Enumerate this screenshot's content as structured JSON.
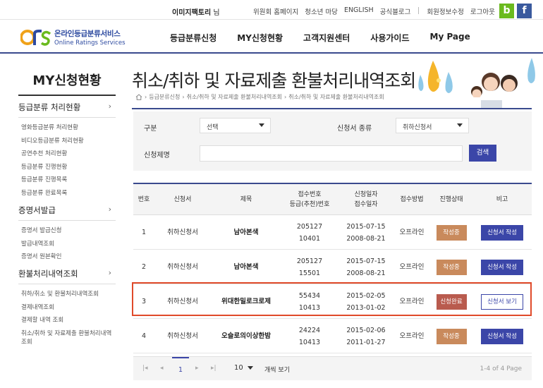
{
  "topbar": {
    "user_name": "이미지팩토리",
    "user_suffix": "님",
    "links": [
      "위원회 홈페이지",
      "청소년 마당",
      "ENGLISH",
      "공식블로그"
    ],
    "account_links": [
      "회원정보수정",
      "로그아웃"
    ],
    "blog_icon_text": "b",
    "facebook_icon_text": "f"
  },
  "header": {
    "logo_ko": "온라인등급분류서비스",
    "logo_en": "Online Ratings Services",
    "nav": [
      "등급분류신청",
      "MY신청현황",
      "고객지원센터",
      "사용가이드",
      "My Page"
    ]
  },
  "sidebar": {
    "title": "MY신청현황",
    "groups": [
      {
        "title": "등급분류 처리현황",
        "items": [
          "영화등급분류 처리현황",
          "비디오등급분류 처리현황",
          "공연추천 처리현황",
          "등급분류 진행현황",
          "등급분류 진행목록",
          "등급분류 완료목록"
        ]
      },
      {
        "title": "증명서발급",
        "items": [
          "증명서 발급신청",
          "발급내역조회",
          "증명서 원본확인"
        ]
      },
      {
        "title": "환불처리내역조회",
        "items": [
          "취하/취소 및 환불처리내역조회",
          "결제내역조회",
          "결제할 내역 조회",
          "취소/취하 및 자료제출 환불처리내역조회"
        ]
      }
    ]
  },
  "page": {
    "title": "취소/취하 및 자료제출 환불처리내역조회",
    "breadcrumb": [
      "등급분류신청",
      "취소/취하 및 자료제출 환불처리내역조회",
      "취소/취하 및 자료제출 환불처리내역조회"
    ]
  },
  "search": {
    "type_label": "구분",
    "type_value": "선택",
    "doc_label": "신청서 종류",
    "doc_value": "취하신청서",
    "name_label": "신청제명",
    "name_value": "",
    "submit_label": "검색"
  },
  "table": {
    "headers": {
      "no": "번호",
      "form": "신청서",
      "title": "제목",
      "receipt_1": "접수번호",
      "receipt_2": "등급(추천)번호",
      "date_1": "신청일자",
      "date_2": "접수일자",
      "method": "접수방법",
      "status": "진행상태",
      "note": "비고"
    },
    "rows": [
      {
        "no": "1",
        "form": "취하신청서",
        "title": "남아본색",
        "receipt_no": "205127",
        "rating_no": "10401",
        "apply_date": "2015-07-15",
        "receipt_date": "2008-08-21",
        "method": "오프라인",
        "status": "작성중",
        "action": "신청서 작성"
      },
      {
        "no": "2",
        "form": "취하신청서",
        "title": "남아본색",
        "receipt_no": "205127",
        "rating_no": "15501",
        "apply_date": "2015-07-15",
        "receipt_date": "2008-08-21",
        "method": "오프라인",
        "status": "작성중",
        "action": "신청서 작성"
      },
      {
        "no": "3",
        "form": "취하신청서",
        "title": "위대한밀로크로제",
        "receipt_no": "55434",
        "rating_no": "10413",
        "apply_date": "2015-02-05",
        "receipt_date": "2013-01-02",
        "method": "오프라인",
        "status": "신청완료",
        "action": "신청서 보기"
      },
      {
        "no": "4",
        "form": "취하신청서",
        "title": "오슬로의이상한밤",
        "receipt_no": "24224",
        "rating_no": "10413",
        "apply_date": "2015-02-06",
        "receipt_date": "2011-01-27",
        "method": "오프라인",
        "status": "작성중",
        "action": "신청서 작성"
      }
    ]
  },
  "pagination": {
    "current_page": "1",
    "per_page": "10",
    "per_page_label": "개씩 보기",
    "info": "1-4 of 4 Page"
  },
  "colors": {
    "brand_navy": "#3a4a8e",
    "button_blue": "#3b46a8",
    "status_writing": "#c98a5c",
    "status_done": "#b95b4e",
    "highlight": "#e04a2a"
  }
}
